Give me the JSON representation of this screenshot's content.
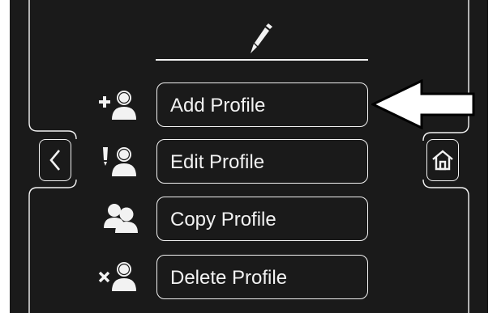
{
  "colors": {
    "background": "#1a1a1a",
    "foreground": "#f2f2f2",
    "callout_arrow": "#ffffff"
  },
  "header": {
    "icon": "pencil-icon"
  },
  "nav": {
    "back_icon": "chevron-left-icon",
    "home_icon": "home-icon"
  },
  "menu": [
    {
      "label": "Add Profile",
      "icon": "add-user-icon"
    },
    {
      "label": "Edit Profile",
      "icon": "edit-user-icon"
    },
    {
      "label": "Copy Profile",
      "icon": "copy-users-icon"
    },
    {
      "label": "Delete Profile",
      "icon": "delete-user-icon"
    }
  ],
  "callout": {
    "target": "Add Profile",
    "icon": "pointer-arrow-icon"
  }
}
